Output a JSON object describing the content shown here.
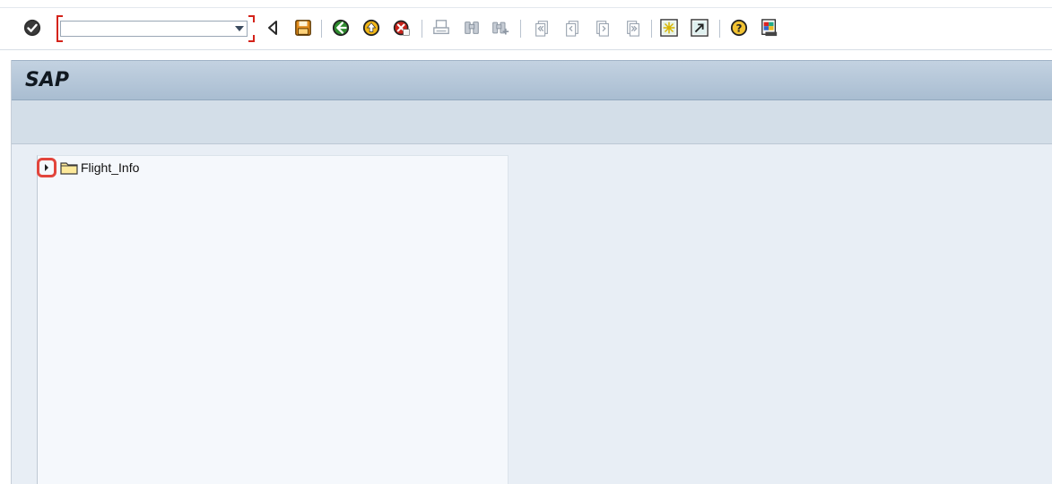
{
  "command_field": {
    "value": "",
    "placeholder": ""
  },
  "toolbar": {
    "buttons": [
      {
        "name": "enter-icon"
      },
      {
        "name": "back-triangle-icon"
      },
      {
        "name": "save-icon"
      },
      {
        "name": "back-icon"
      },
      {
        "name": "exit-icon"
      },
      {
        "name": "cancel-icon"
      },
      {
        "name": "print-icon"
      },
      {
        "name": "find-icon"
      },
      {
        "name": "find-next-icon"
      },
      {
        "name": "first-page-icon"
      },
      {
        "name": "previous-page-icon"
      },
      {
        "name": "next-page-icon"
      },
      {
        "name": "last-page-icon"
      },
      {
        "name": "create-session-icon"
      },
      {
        "name": "shortcut-icon"
      },
      {
        "name": "help-icon"
      },
      {
        "name": "customize-layout-icon"
      }
    ],
    "colors": {
      "enter_green": "#2c8a2c",
      "save_orange": "#e08a1b",
      "nav_green": "#2e8b2e",
      "exit_yellow": "#f1b616",
      "cancel_red": "#c8231b",
      "disabled_gray": "#9aa4b0"
    }
  },
  "window": {
    "title": "SAP"
  },
  "tree": {
    "nodes": [
      {
        "label": "Flight_Info",
        "icon": "folder-icon",
        "expanded": false
      }
    ]
  },
  "colors": {
    "title_bar": "#b3c5d8",
    "app_bar": "#d3dee8",
    "content_bg": "#e8eef5",
    "tree_bg": "#f5f8fc",
    "highlight_red": "#e2453c"
  }
}
